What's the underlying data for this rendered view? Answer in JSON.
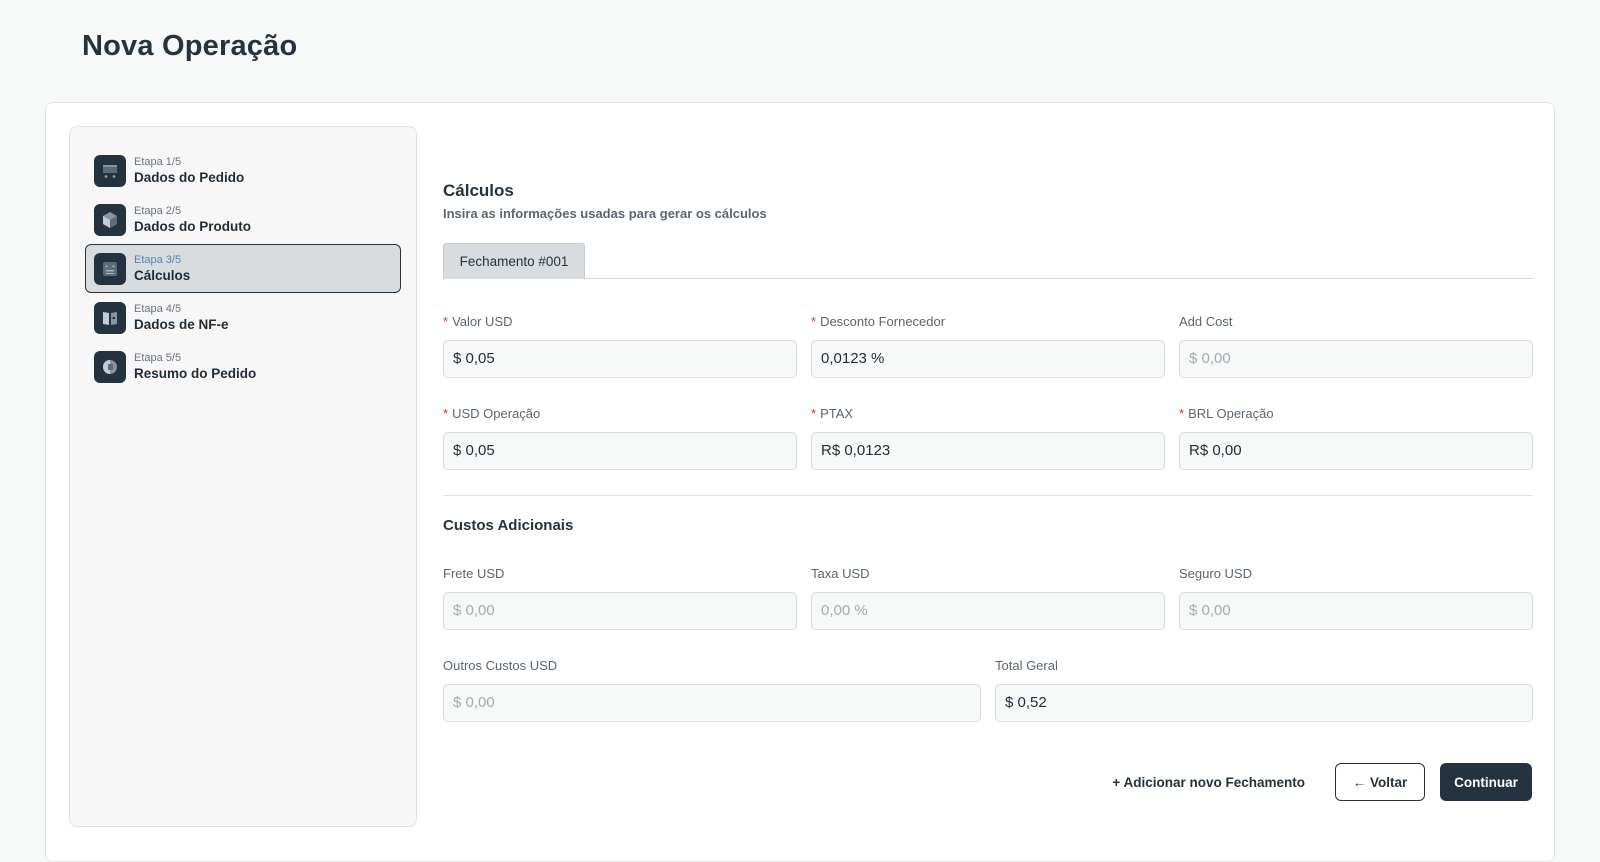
{
  "page": {
    "title": "Nova Operação"
  },
  "steps": [
    {
      "count": "Etapa 1/5",
      "label": "Dados do Pedido",
      "icon": "cart-icon"
    },
    {
      "count": "Etapa 2/5",
      "label": "Dados do Produto",
      "icon": "box-icon"
    },
    {
      "count": "Etapa 3/5",
      "label": "Cálculos",
      "icon": "calculator-icon",
      "active": true
    },
    {
      "count": "Etapa 4/5",
      "label": "Dados de NF-e",
      "icon": "document-icon"
    },
    {
      "count": "Etapa 5/5",
      "label": "Resumo do Pedido",
      "icon": "summary-icon"
    }
  ],
  "section": {
    "title": "Cálculos",
    "subtitle": "Insira as informações usadas para gerar os cálculos"
  },
  "tabs": [
    {
      "label": "Fechamento #001"
    }
  ],
  "fields": {
    "valor_usd": {
      "label": "Valor USD",
      "required": true,
      "value": "$ 0,05"
    },
    "desconto_fornecedor": {
      "label": "Desconto Fornecedor",
      "required": true,
      "value": "0,0123 %"
    },
    "add_cost": {
      "label": "Add Cost",
      "required": false,
      "placeholder": "$ 0,00"
    },
    "usd_operacao": {
      "label": "USD Operação",
      "required": true,
      "value": "$ 0,05"
    },
    "ptax": {
      "label": "PTAX",
      "required": true,
      "value": "R$ 0,0123"
    },
    "brl_operacao": {
      "label": "BRL Operação",
      "required": true,
      "value": "R$ 0,00"
    }
  },
  "custos": {
    "title": "Custos Adicionais",
    "frete_usd": {
      "label": "Frete USD",
      "placeholder": "$ 0,00"
    },
    "taxa_usd": {
      "label": "Taxa USD",
      "placeholder": "0,00 %"
    },
    "seguro_usd": {
      "label": "Seguro USD",
      "placeholder": "$ 0,00"
    },
    "outros_custos_usd": {
      "label": "Outros Custos USD",
      "placeholder": "$ 0,00"
    },
    "total_geral": {
      "label": "Total Geral",
      "value": "$ 0,52"
    }
  },
  "actions": {
    "add_fechamento": "+ Adicionar novo Fechamento",
    "voltar": "← Voltar",
    "continuar": "Continuar"
  },
  "required_mark": "*",
  "colors": {
    "primary": "#24333f",
    "required": "#d0312d",
    "active_step_count": "#4a86b8"
  }
}
